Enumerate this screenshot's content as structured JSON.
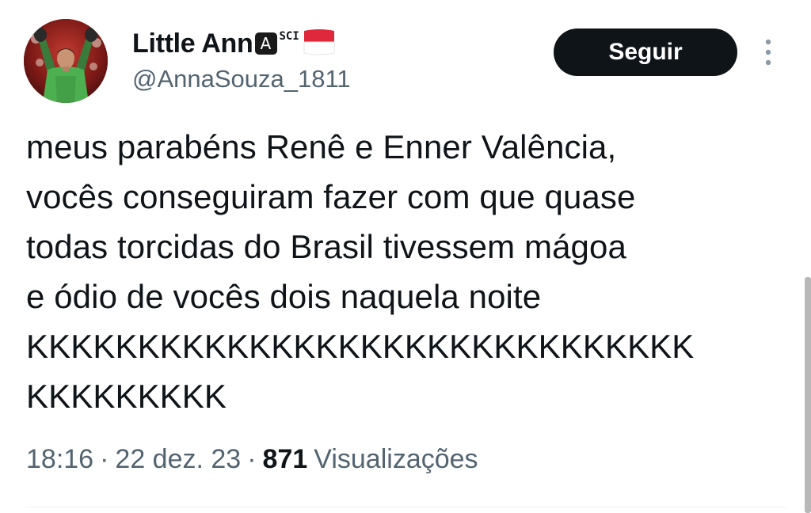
{
  "user": {
    "display_name": "Little Ann",
    "badge_letter": "A",
    "badge_suffix": "SCI",
    "flag_icon": "indonesia-flag-icon",
    "handle": "@AnnaSouza_1811",
    "avatar_icon": "goalkeeper-avatar"
  },
  "actions": {
    "follow_label": "Seguir",
    "more_icon": "more-vertical-icon"
  },
  "tweet": {
    "text": "meus parabéns Renê e Enner Valência,\nvocês conseguiram fazer com que quase\ntodas torcidas do Brasil tivessem mágoa\ne ódio de vocês dois naquela noite\nKKKKKKKKKKKKKKKKKKKKKKKKKKKKKK\nKKKKKKKKK"
  },
  "meta": {
    "time": "18:16",
    "separator": "·",
    "date": "22 dez. 23",
    "views_count": "871",
    "views_label": "Visualizações"
  },
  "colors": {
    "text_primary": "#0f1419",
    "text_secondary": "#536471",
    "button_bg": "#0f1419"
  }
}
